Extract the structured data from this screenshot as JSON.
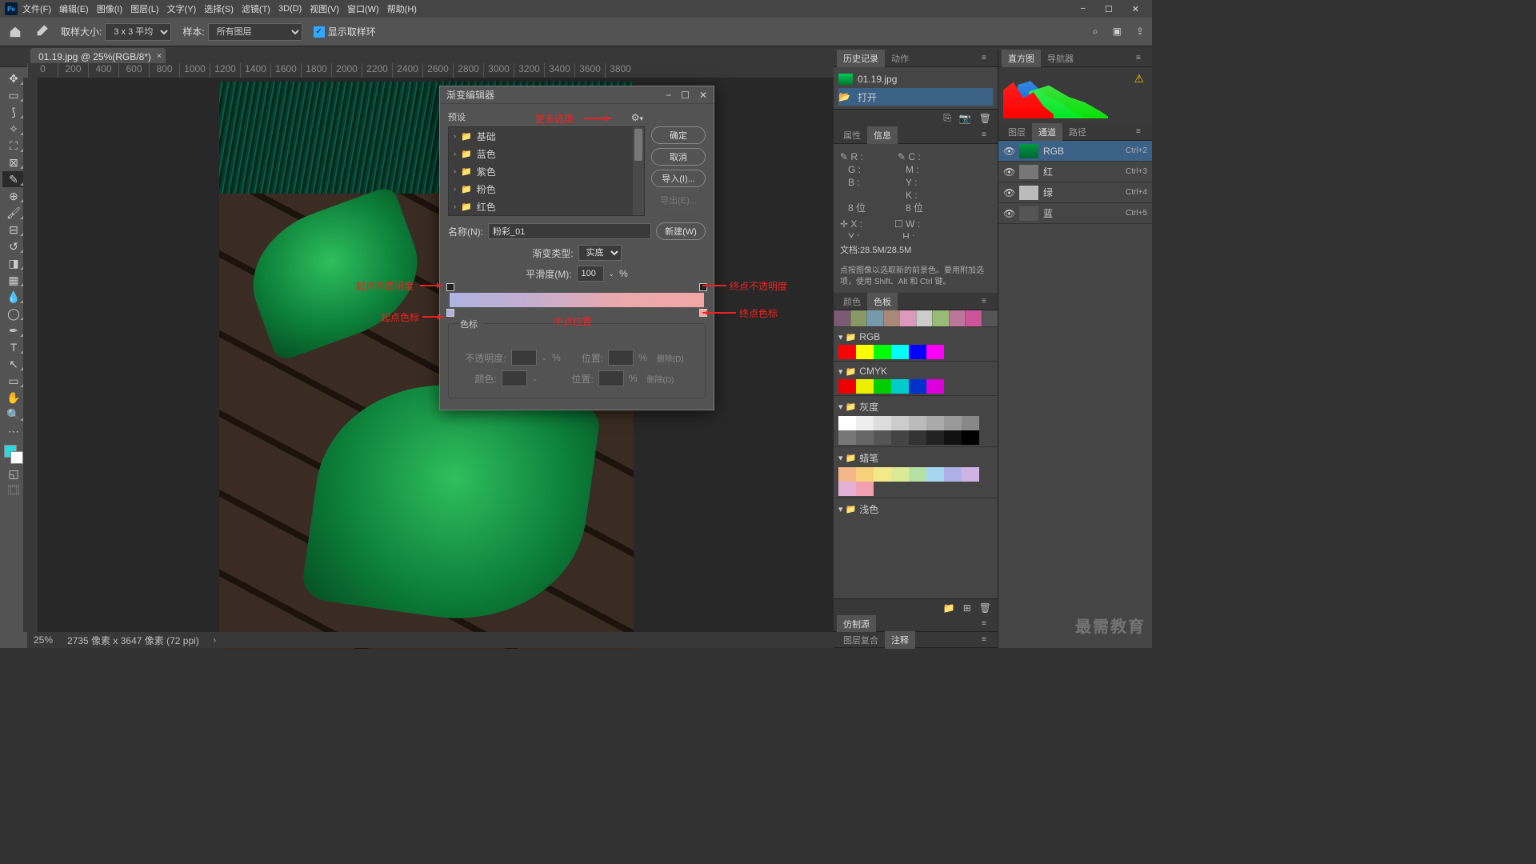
{
  "menu": {
    "items": [
      "文件(F)",
      "编辑(E)",
      "图像(I)",
      "图层(L)",
      "文字(Y)",
      "选择(S)",
      "滤镜(T)",
      "3D(D)",
      "视图(V)",
      "窗口(W)",
      "帮助(H)"
    ]
  },
  "options": {
    "sample_label": "取样大小:",
    "sample_val": "3 x 3 平均",
    "layers_label": "样本:",
    "layers_val": "所有图层",
    "ring": "显示取样环"
  },
  "tab": {
    "title": "01.19.jpg @ 25%(RGB/8*)"
  },
  "ruler": [
    "0",
    "200",
    "400",
    "600",
    "800",
    "1000",
    "1200",
    "1400",
    "1600",
    "1800",
    "2000",
    "2200",
    "2400",
    "2600",
    "2800",
    "3000",
    "3200",
    "3400",
    "3600",
    "3800"
  ],
  "status": {
    "zoom": "25%",
    "dims": "2735 像素 x 3647 像素 (72 ppi)"
  },
  "dialog": {
    "title": "渐变编辑器",
    "presets_label": "预设",
    "folders": [
      "基础",
      "蓝色",
      "紫色",
      "粉色",
      "红色"
    ],
    "more": "更多选项",
    "btn_ok": "确定",
    "btn_cancel": "取消",
    "btn_import": "导入(I)...",
    "btn_export": "导出(E)...",
    "btn_new": "新建(W)",
    "name_label": "名称(N):",
    "name_val": "粉彩_01",
    "type_label": "渐变类型:",
    "type_val": "实底",
    "smooth_label": "平滑度(M):",
    "smooth_val": "100",
    "pct": "%",
    "stops_title": "色标",
    "opacity_label": "不透明度:",
    "pos_label": "位置:",
    "delete_label": "删除(D)",
    "color_label": "颜色:",
    "ann_start_op": "起点不透明度",
    "ann_end_op": "终点不透明度",
    "ann_start_stop": "起点色标",
    "ann_end_stop": "终点色标",
    "ann_mid": "中点位置"
  },
  "panels": {
    "history": "历史记录",
    "actions": "动作",
    "hist_file": "01.19.jpg",
    "hist_open": "打开",
    "histogram": "直方图",
    "nav": "导航器",
    "layers": "图层",
    "channels": "通道",
    "paths": "路径",
    "props": "属性",
    "info": "信息",
    "info_r": "R :",
    "info_g": "G :",
    "info_b": "B :",
    "info_c": "C :",
    "info_m": "M :",
    "info_y": "Y :",
    "info_k": "K :",
    "info_bit": "8 位",
    "info_bit2": "8 位",
    "info_x": "X :",
    "info_y2": "Y :",
    "info_w": "W :",
    "info_h": "H :",
    "info_doc": "文档:28.5M/28.5M",
    "info_hint": "点按图像以选取新的前景色。要用附加选项，使用 Shift、Alt 和 Ctrl 键。",
    "colors": "颜色",
    "swatches": "色板",
    "rgb": "RGB",
    "cmyk": "CMYK",
    "gray": "灰度",
    "crayon": "蜡笔",
    "light": "浅色",
    "ch_rgb": "RGB",
    "ch_r": "红",
    "ch_g": "绿",
    "ch_b": "蓝",
    "sc_rgb": "Ctrl+2",
    "sc_r": "Ctrl+3",
    "sc_g": "Ctrl+4",
    "sc_b": "Ctrl+5",
    "clone": "仿制源",
    "layercomp": "图层复合",
    "note": "注释"
  },
  "watermark": "最需教育"
}
